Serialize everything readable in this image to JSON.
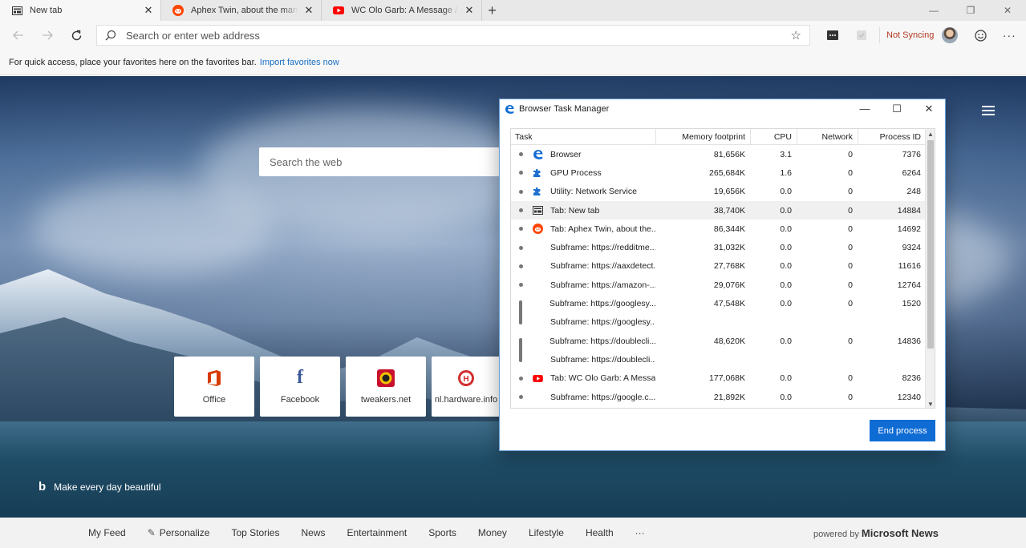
{
  "tabs": [
    {
      "title": "New tab",
      "icon": "newtab-icon",
      "active": true
    },
    {
      "title": "Aphex Twin, about the man the myth",
      "icon": "reddit-icon",
      "active": false
    },
    {
      "title": "WC Olo Garb: A Message / Leftover",
      "icon": "youtube-icon",
      "active": false
    }
  ],
  "address": {
    "placeholder": "Search or enter web address"
  },
  "sync": {
    "label": "Not Syncing"
  },
  "favbar": {
    "text": "For quick access, place your favorites here on the favorites bar.",
    "link": "Import favorites now"
  },
  "page": {
    "search_placeholder": "Search the web",
    "tiles": [
      {
        "label": "Office",
        "icon": "office-icon",
        "color": "#d83b01"
      },
      {
        "label": "Facebook",
        "icon": "facebook-icon",
        "color": "#3b5998"
      },
      {
        "label": "tweakers.net",
        "icon": "tweakers-icon",
        "color": "#c8102e"
      },
      {
        "label": "nl.hardware.info",
        "icon": "hardware-info-icon",
        "color": "#d32f2f"
      }
    ],
    "bing_caption": "Make every day beautiful"
  },
  "feed": {
    "items": [
      "My Feed",
      "Personalize",
      "Top Stories",
      "News",
      "Entertainment",
      "Sports",
      "Money",
      "Lifestyle",
      "Health",
      "···"
    ],
    "powered_prefix": "powered by",
    "powered_brand": "Microsoft News"
  },
  "task_manager": {
    "title": "Browser Task Manager",
    "columns": {
      "task": "Task",
      "memory": "Memory footprint",
      "cpu": "CPU",
      "network": "Network",
      "pid": "Process ID"
    },
    "rows": [
      {
        "icon": "edge-icon",
        "task": "Browser",
        "memory": "81,656K",
        "cpu": "3.1",
        "network": "0",
        "pid": "7376",
        "bullet": "dot"
      },
      {
        "icon": "puzzle-icon",
        "task": "GPU Process",
        "memory": "265,684K",
        "cpu": "1.6",
        "network": "0",
        "pid": "6264",
        "bullet": "dot"
      },
      {
        "icon": "puzzle-icon",
        "task": "Utility: Network Service",
        "memory": "19,656K",
        "cpu": "0.0",
        "network": "0",
        "pid": "248",
        "bullet": "dot"
      },
      {
        "icon": "newtab-icon",
        "task": "Tab: New tab",
        "memory": "38,740K",
        "cpu": "0.0",
        "network": "0",
        "pid": "14884",
        "bullet": "dot",
        "selected": true
      },
      {
        "icon": "reddit-icon",
        "task": "Tab: Aphex Twin, about the...",
        "memory": "86,344K",
        "cpu": "0.0",
        "network": "0",
        "pid": "14692",
        "bullet": "dot"
      },
      {
        "icon": "",
        "task": "Subframe: https://redditme...",
        "memory": "31,032K",
        "cpu": "0.0",
        "network": "0",
        "pid": "9324",
        "bullet": "dot"
      },
      {
        "icon": "",
        "task": "Subframe: https://aaxdetect...",
        "memory": "27,768K",
        "cpu": "0.0",
        "network": "0",
        "pid": "11616",
        "bullet": "dot"
      },
      {
        "icon": "",
        "task": "Subframe: https://amazon-...",
        "memory": "29,076K",
        "cpu": "0.0",
        "network": "0",
        "pid": "12764",
        "bullet": "dot"
      },
      {
        "icon": "",
        "task": "Subframe: https://googlesy...",
        "memory": "47,548K",
        "cpu": "0.0",
        "network": "0",
        "pid": "1520",
        "bullet": "bar"
      },
      {
        "icon": "",
        "task": "Subframe: https://googlesy...",
        "memory": "",
        "cpu": "",
        "network": "",
        "pid": "",
        "bullet": "none"
      },
      {
        "icon": "",
        "task": "Subframe: https://doublecli...",
        "memory": "48,620K",
        "cpu": "0.0",
        "network": "0",
        "pid": "14836",
        "bullet": "bar"
      },
      {
        "icon": "",
        "task": "Subframe: https://doublecli...",
        "memory": "",
        "cpu": "",
        "network": "",
        "pid": "",
        "bullet": "none"
      },
      {
        "icon": "youtube-icon",
        "task": "Tab: WC Olo Garb: A Messa...",
        "memory": "177,068K",
        "cpu": "0.0",
        "network": "0",
        "pid": "8236",
        "bullet": "dot"
      },
      {
        "icon": "",
        "task": "Subframe: https://google.c...",
        "memory": "21,892K",
        "cpu": "0.0",
        "network": "0",
        "pid": "12340",
        "bullet": "dot"
      }
    ],
    "end_button": "End process"
  }
}
